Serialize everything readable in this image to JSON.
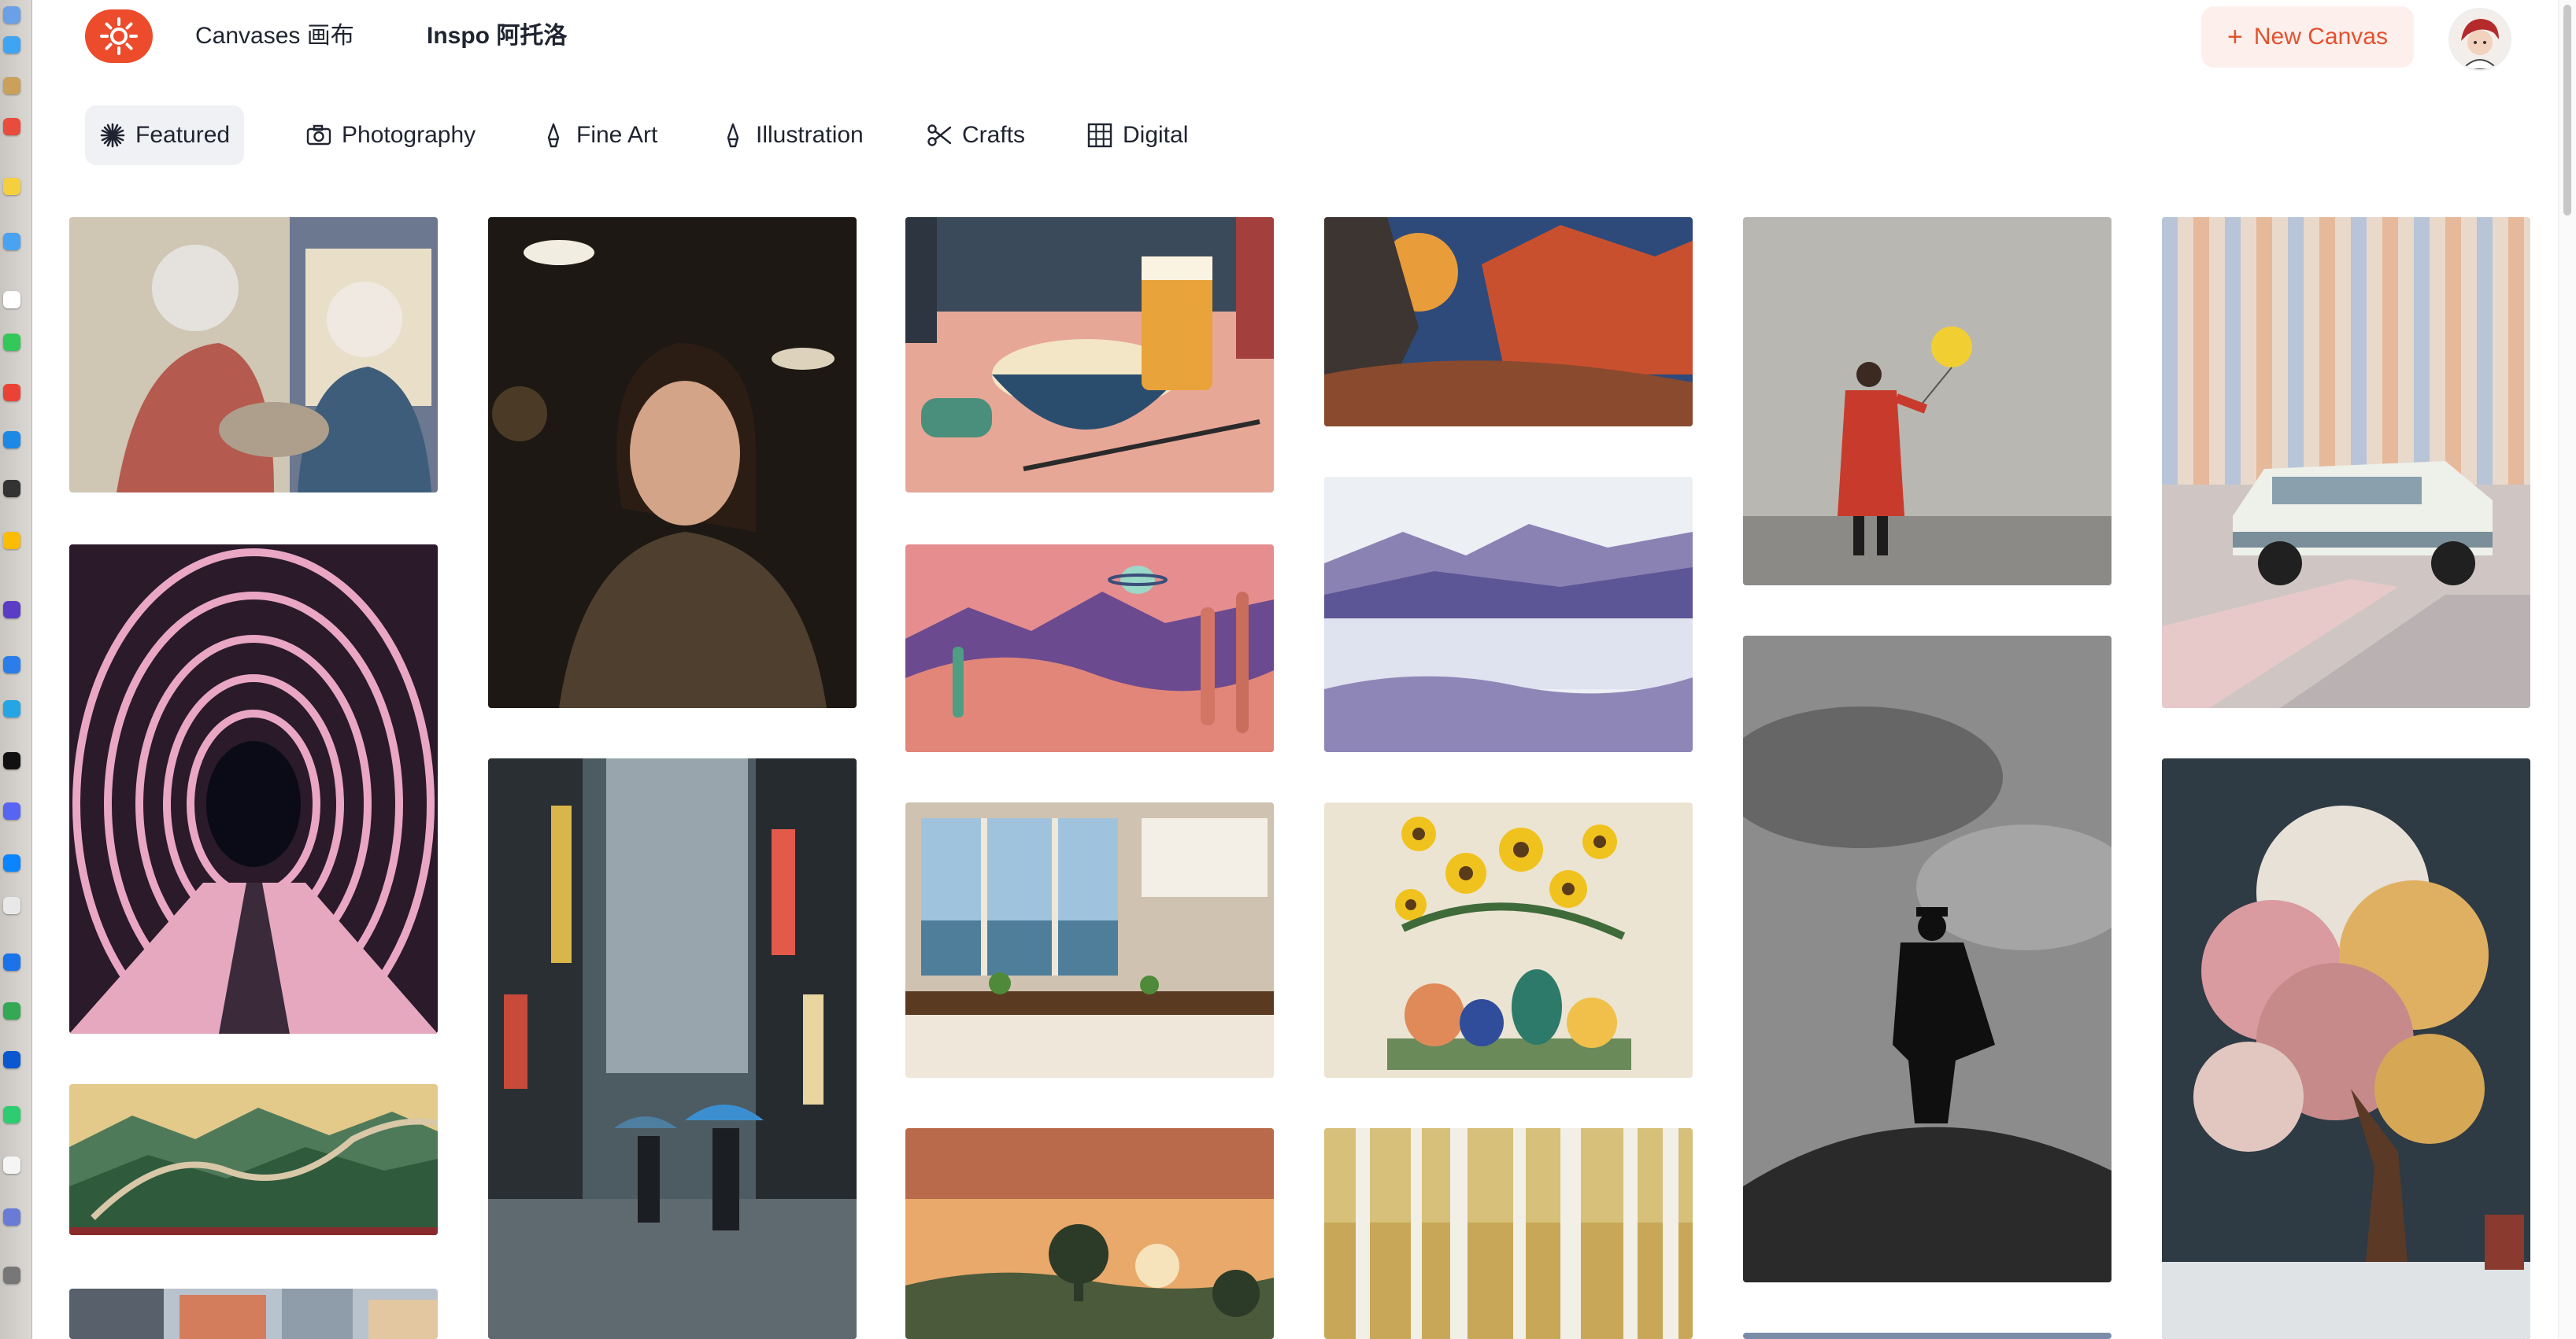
{
  "header": {
    "canvases_label": "Canvases 画布",
    "inspo_label": "Inspo 阿托洛",
    "new_canvas_label": "New Canvas"
  },
  "tabs": [
    {
      "label": "Featured",
      "icon": "sparkle-icon",
      "active": true
    },
    {
      "label": "Photography",
      "icon": "camera-icon",
      "active": false
    },
    {
      "label": "Fine Art",
      "icon": "pen-nib-icon",
      "active": false
    },
    {
      "label": "Illustration",
      "icon": "pen-nib-icon",
      "active": false
    },
    {
      "label": "Crafts",
      "icon": "scissors-icon",
      "active": false
    },
    {
      "label": "Digital",
      "icon": "grid-icon",
      "active": false
    }
  ],
  "gallery": {
    "images": [
      "pop-art-elderly-women",
      "portrait-woman-bokeh",
      "pop-art-ramen-and-beer",
      "desert-canyon-painting",
      "woman-red-coat-yellow-balloon",
      "white-suv-pastel-wall",
      "pink-neon-tunnel",
      "rainy-city-street-umbrellas",
      "retro-desert-planet-illustration",
      "watercolor-mountain-lake",
      "man-in-hat-on-rock-bw",
      "blossom-tree-snow-painting",
      "great-wall-embroidery",
      "sunny-kitchen-window",
      "sunflowers-in-vases",
      "sunset-landscape-print",
      "birch-forest",
      "city-street-buildings"
    ]
  },
  "colors": {
    "brand": "#ec4b2c",
    "new_canvas_bg": "#fdf0ec",
    "active_tab_bg": "#eff1f4"
  }
}
